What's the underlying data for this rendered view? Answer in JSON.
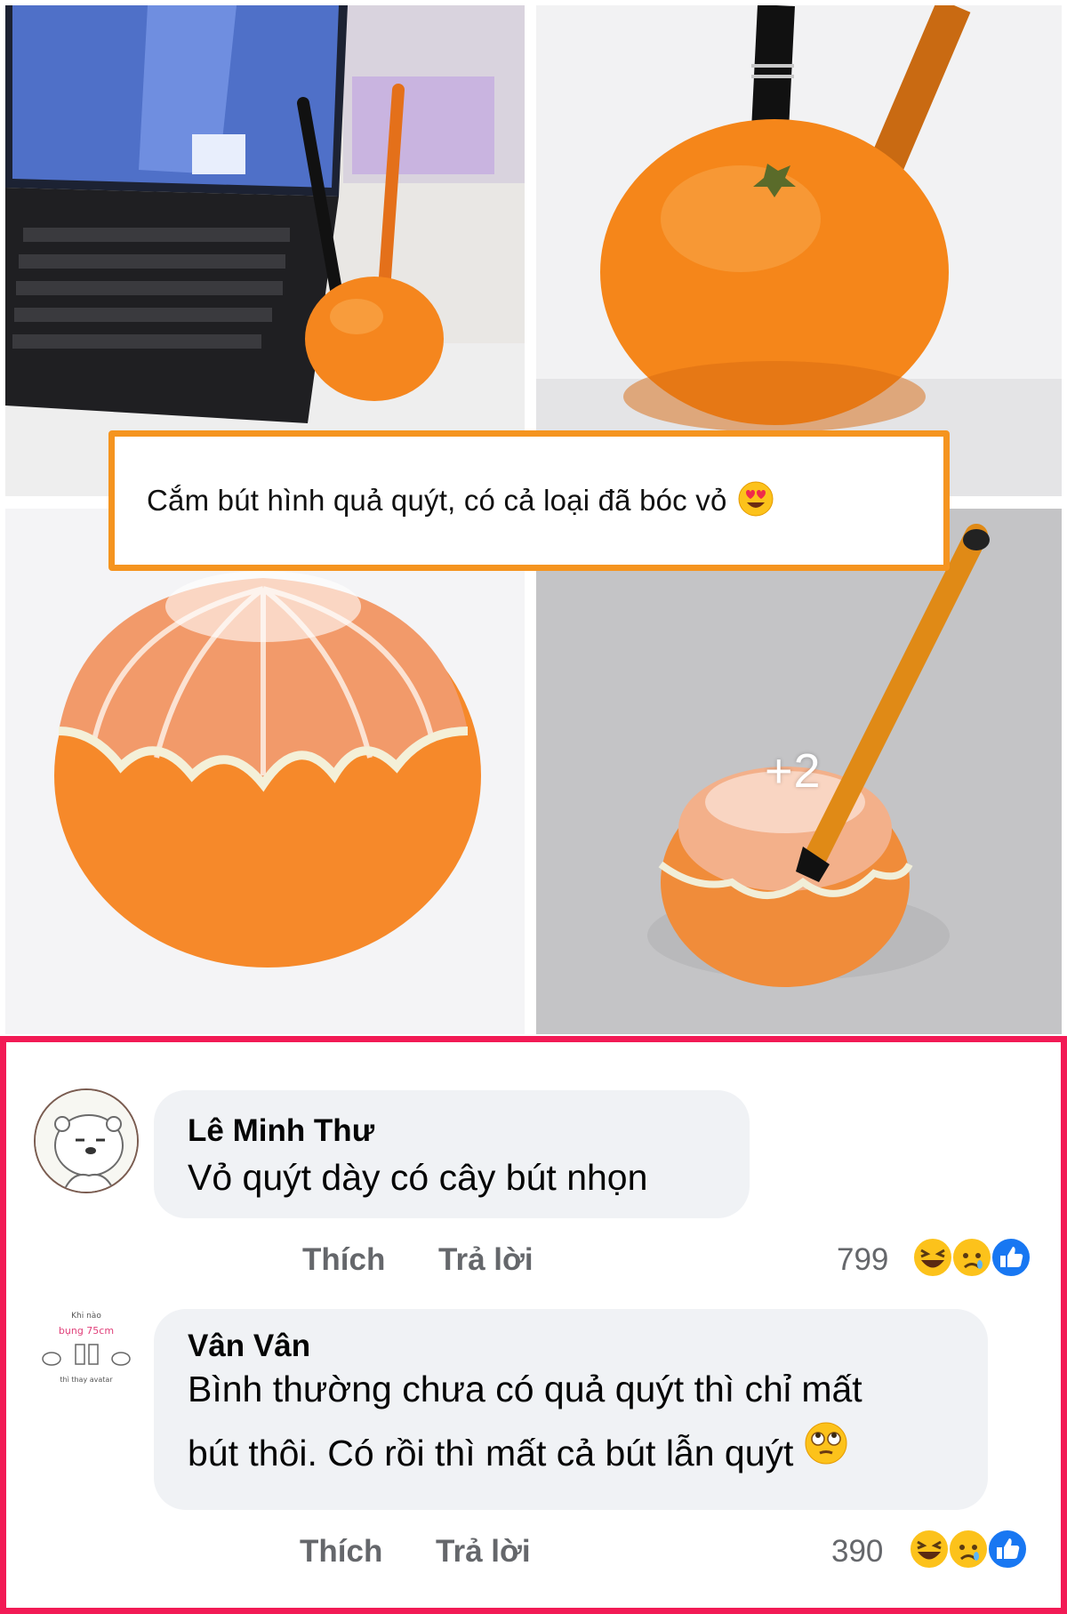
{
  "post": {
    "caption": "Cắm bút hình quả quýt, có cả loại đã bóc vỏ",
    "caption_emoji": "heart-eyes-emoji",
    "more_photos_label": "+2",
    "photos": [
      {
        "subject": "orange-pen-holder-laptop"
      },
      {
        "subject": "orange-pen-holder-closeup"
      },
      {
        "subject": "peeled-orange"
      },
      {
        "subject": "peeled-orange-with-pen"
      }
    ]
  },
  "comments": [
    {
      "author": "Lê Minh Thư",
      "text": "Vỏ quýt dày có cây bút nhọn",
      "like_label": "Thích",
      "reply_label": "Trả lời",
      "reaction_count": "799",
      "reactions": [
        "haha-icon",
        "sad-icon",
        "like-icon"
      ]
    },
    {
      "author": "Vân Vân",
      "text_line1": "Bình thường chưa có quả quýt thì chỉ mất",
      "text_line2": "bút thôi. Có rồi thì mất cả bút lẫn quýt",
      "text_emoji": "eye-roll-emoji",
      "like_label": "Thích",
      "reply_label": "Trả lời",
      "reaction_count": "390",
      "reactions": [
        "haha-icon",
        "sad-icon",
        "like-icon"
      ],
      "avatar_text": {
        "line1": "Khi nào",
        "line2": "bụng 75cm",
        "line3": "thì thay avatar"
      }
    }
  ],
  "colors": {
    "caption_border": "#f5941f",
    "comments_border": "#f21a55",
    "bubble": "#f0f2f5",
    "muted": "#65676b",
    "like_blue": "#1877f2"
  }
}
